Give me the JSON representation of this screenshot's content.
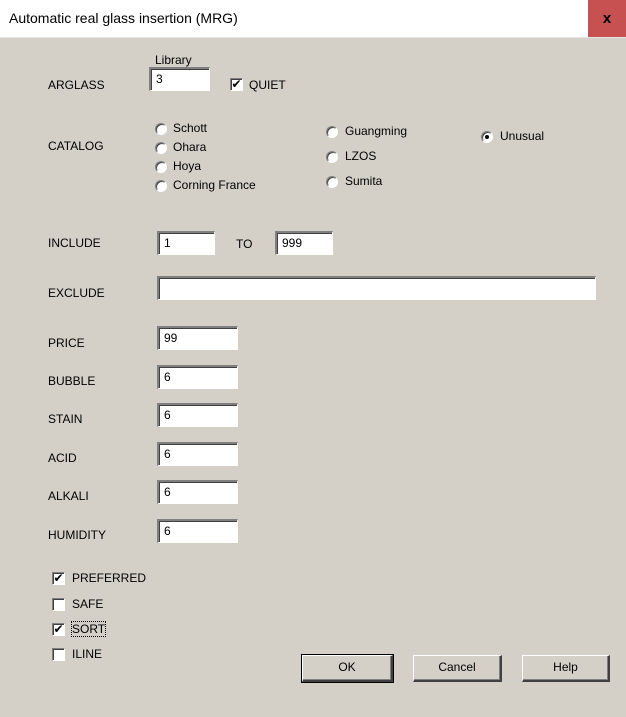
{
  "window": {
    "title": "Automatic real glass insertion (MRG)",
    "close_label": "x"
  },
  "arglass": {
    "label": "ARGLASS",
    "library_label": "Library",
    "value": "3",
    "quiet_label": "QUIET",
    "quiet_checked": "✔"
  },
  "catalog": {
    "label": "CATALOG",
    "options": [
      "Schott",
      "Ohara",
      "Hoya",
      "Corning France",
      "Guangming",
      "LZOS",
      "Sumita",
      "Unusual"
    ],
    "selected": "Unusual"
  },
  "include": {
    "label": "INCLUDE",
    "from": "1",
    "to_label": "TO",
    "to": "999"
  },
  "exclude": {
    "label": "EXCLUDE",
    "value": ""
  },
  "fields": {
    "price": {
      "label": "PRICE",
      "value": "99"
    },
    "bubble": {
      "label": "BUBBLE",
      "value": "6"
    },
    "stain": {
      "label": "STAIN",
      "value": "6"
    },
    "acid": {
      "label": "ACID",
      "value": "6"
    },
    "alkali": {
      "label": "ALKALI",
      "value": "6"
    },
    "humidity": {
      "label": "HUMIDITY",
      "value": "6"
    }
  },
  "options": {
    "preferred": {
      "label": "PREFERRED",
      "mark": "✔"
    },
    "safe": {
      "label": "SAFE",
      "mark": ""
    },
    "sort": {
      "label": "SORT",
      "mark": "✔"
    },
    "iline": {
      "label": "ILINE",
      "mark": ""
    }
  },
  "buttons": {
    "ok": "OK",
    "cancel": "Cancel",
    "help": "Help"
  }
}
